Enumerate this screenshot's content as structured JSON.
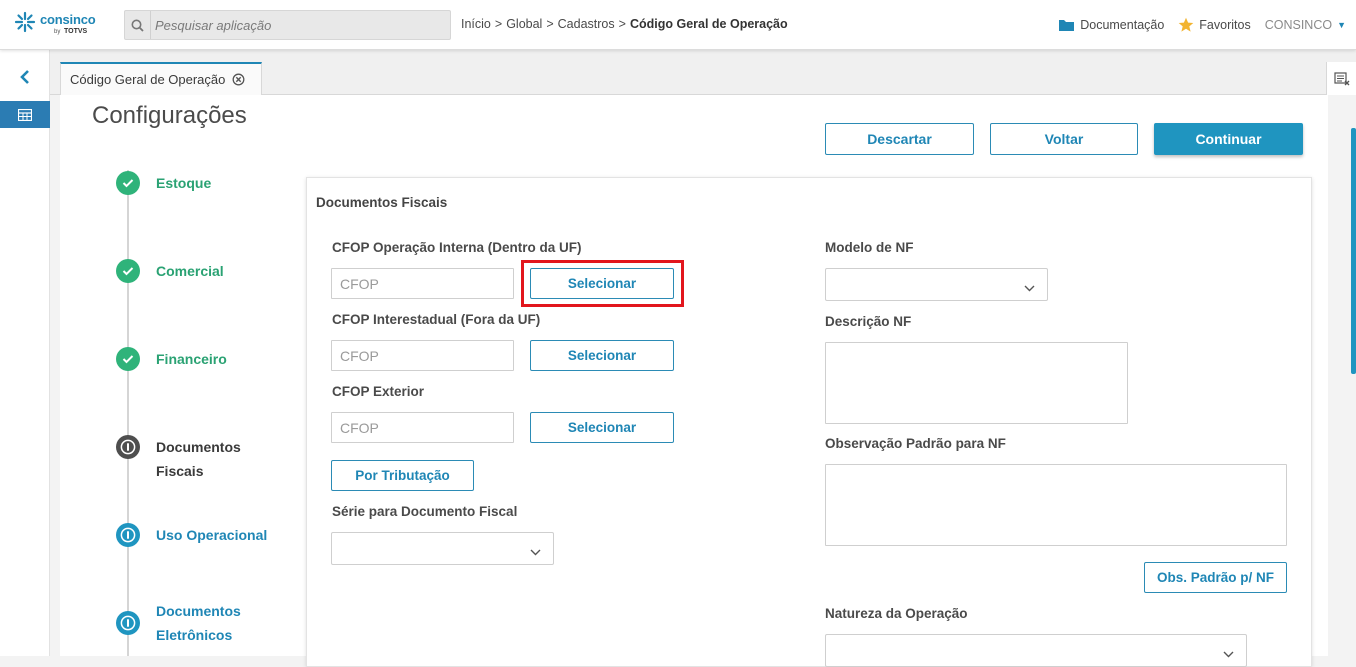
{
  "header": {
    "logo_brand": "consinco",
    "logo_by": "by",
    "logo_totvs": "TOTVS",
    "search_placeholder": "Pesquisar aplicação",
    "breadcrumb": [
      "Início",
      "Global",
      "Cadastros",
      "Código Geral de Operação"
    ],
    "breadcrumb_sep": ">",
    "links": {
      "docs": "Documentação",
      "favorites": "Favoritos"
    },
    "user": "CONSINCO",
    "icons": {
      "search": "search-icon",
      "docs": "folder-icon",
      "favorites": "star-icon",
      "user_menu": "caret-down-icon"
    },
    "colors": {
      "brand": "#1f86b5",
      "favorites_star": "#f2b431",
      "folder": "#1f86b5"
    }
  },
  "rail": {
    "icons": [
      "chevron-left-icon",
      "grid-icon"
    ]
  },
  "tabs": [
    {
      "label": "Código Geral de Operação",
      "closable": true
    }
  ],
  "page": {
    "title": "Configurações",
    "actions": {
      "discard": "Descartar",
      "back": "Voltar",
      "continue": "Continuar"
    },
    "steps": [
      {
        "label": "Estoque",
        "status": "done"
      },
      {
        "label": "Comercial",
        "status": "done"
      },
      {
        "label": "Financeiro",
        "status": "done"
      },
      {
        "label": "Documentos Fiscais",
        "status": "current"
      },
      {
        "label": "Uso Operacional",
        "status": "pending"
      },
      {
        "label": "Documentos Eletrônicos",
        "status": "pending"
      }
    ]
  },
  "form": {
    "section_title": "Documentos Fiscais",
    "cfop_internal": {
      "label": "CFOP Operação Interna (Dentro da UF)",
      "placeholder": "CFOP",
      "value": "",
      "button": "Selecionar"
    },
    "cfop_interstate": {
      "label": "CFOP Interestadual (Fora da UF)",
      "placeholder": "CFOP",
      "value": "",
      "button": "Selecionar"
    },
    "cfop_exterior": {
      "label": "CFOP Exterior",
      "placeholder": "CFOP",
      "value": "",
      "button": "Selecionar"
    },
    "by_taxation_button": "Por Tributação",
    "series_label": "Série para Documento Fiscal",
    "series_value": "",
    "nf_model_label": "Modelo de NF",
    "nf_model_value": "",
    "nf_description_label": "Descrição NF",
    "nf_observation_label": "Observação Padrão para NF",
    "obs_default_button": "Obs. Padrão p/ NF",
    "nature_label": "Natureza da Operação",
    "nature_value": ""
  },
  "colors": {
    "accent": "#1f95c0",
    "done": "#2fb37a",
    "current": "#4e4e4e",
    "highlight": "#e2161d"
  }
}
